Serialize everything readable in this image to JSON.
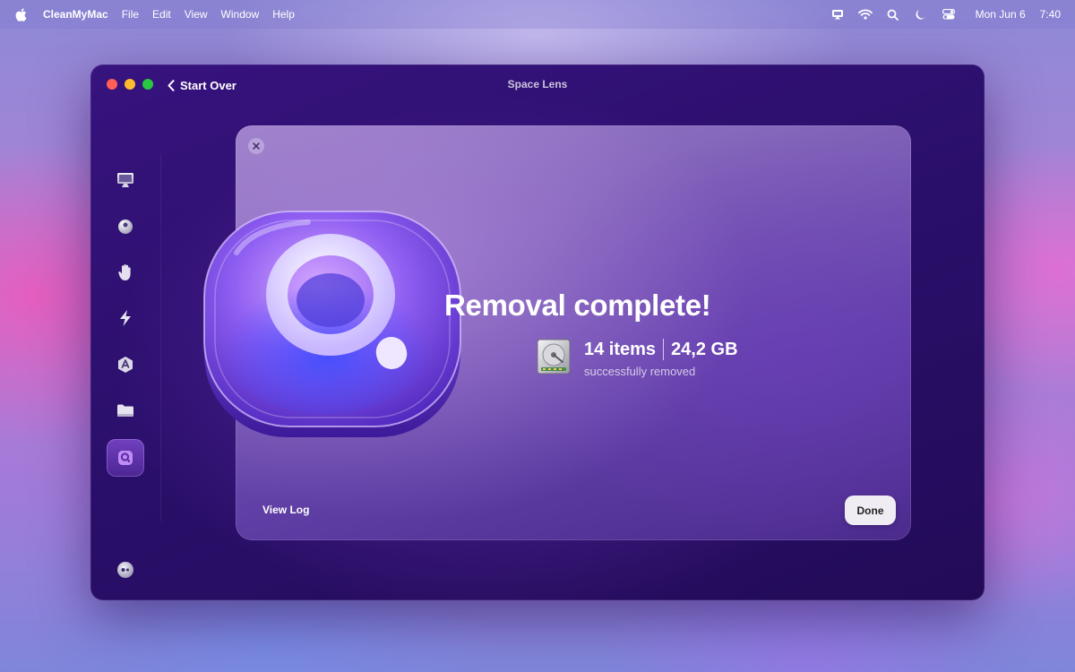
{
  "menubar": {
    "apple_icon": "apple-icon",
    "app_name": "CleanMyMac",
    "items": [
      "File",
      "Edit",
      "View",
      "Window",
      "Help"
    ],
    "status_icons": [
      "screen-mirroring-icon",
      "wifi-icon",
      "search-icon",
      "focus-moon-icon",
      "control-center-icon"
    ],
    "date": "Mon Jun 6",
    "time": "7:40"
  },
  "window": {
    "back_label": "Start Over",
    "title": "Space Lens"
  },
  "sidebar": {
    "items": [
      {
        "name": "smart-scan",
        "icon": "monitor-icon",
        "active": false
      },
      {
        "name": "cleanup",
        "icon": "bubble-icon",
        "active": false
      },
      {
        "name": "protection",
        "icon": "hand-icon",
        "active": false
      },
      {
        "name": "performance",
        "icon": "lightning-icon",
        "active": false
      },
      {
        "name": "applications",
        "icon": "app-store-icon",
        "active": false
      },
      {
        "name": "my-clutter",
        "icon": "folder-icon",
        "active": false
      },
      {
        "name": "space-lens",
        "icon": "space-lens-icon",
        "active": true
      }
    ],
    "assistant_icon": "assistant-icon"
  },
  "card": {
    "headline": "Removal complete!",
    "items_count": "14 items",
    "size": "24,2 GB",
    "subtitle": "successfully removed",
    "view_log_label": "View Log",
    "done_label": "Done"
  },
  "colors": {
    "accent": "#8b5cf6",
    "window_bg": "#2a0f6a",
    "traffic_close": "#ff5f57",
    "traffic_min": "#febc2e",
    "traffic_max": "#28c840"
  }
}
